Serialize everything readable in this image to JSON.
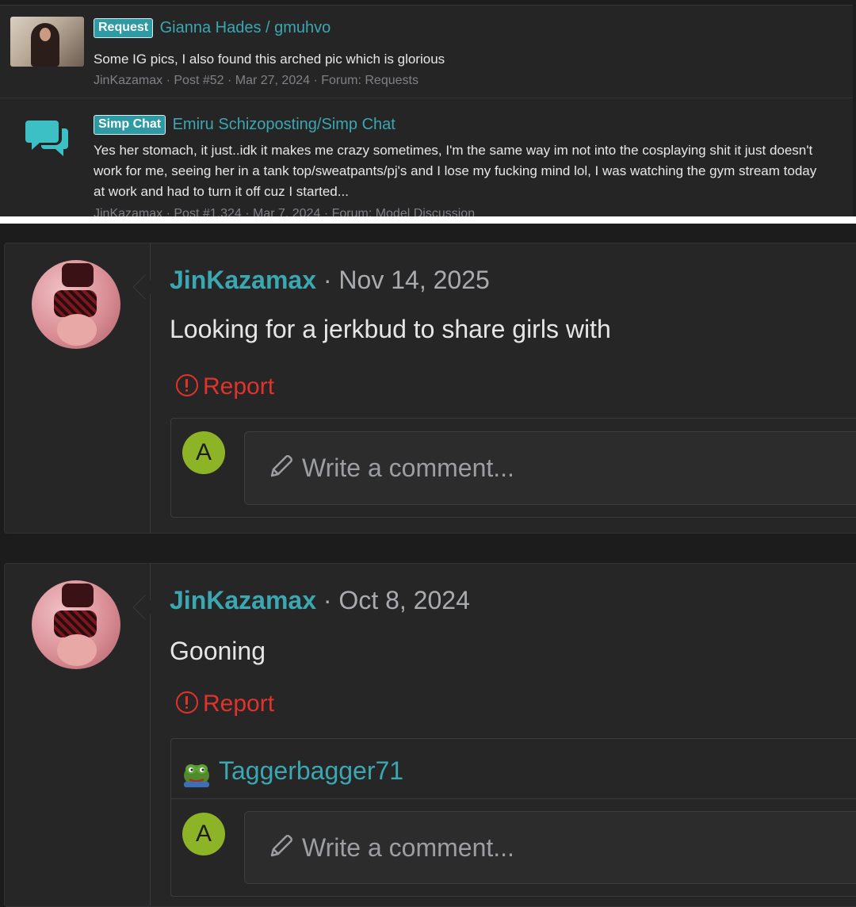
{
  "search_results": [
    {
      "badge": "Request",
      "title": "Gianna Hades / gmuhvo",
      "snippet": "Some IG pics, I also found this arched pic which is glorious",
      "meta": "JinKazamax · Post #52 · Mar 27, 2024 · Forum: Requests"
    },
    {
      "badge": "Simp Chat",
      "title": "Emiru Schizoposting/Simp Chat",
      "snippet": "Yes her stomach, it just..idk it makes me crazy sometimes, I'm the same way im not into the cosplaying shit it just doesn't work for me, seeing her in a tank top/sweatpants/pj's and I lose my fucking mind lol, I was watching the gym stream today at work and had to turn it off cuz I started...",
      "meta": "JinKazamax · Post #1,324 · Mar 7, 2024 · Forum: Model Discussion"
    }
  ],
  "posts": [
    {
      "author": "JinKazamax",
      "date": " · Nov 14, 2025",
      "body": "Looking for a jerkbud to share girls with",
      "report_label": "Report",
      "commenter_initial": "A",
      "comment_placeholder": "Write a comment..."
    },
    {
      "author": "JinKazamax",
      "date": " · Oct 8, 2024",
      "body": "Gooning",
      "report_label": "Report",
      "liker": "Taggerbagger71",
      "commenter_initial": "A",
      "comment_placeholder": "Write a comment..."
    }
  ],
  "colors": {
    "accent": "#3aa7b1",
    "report": "#e0332b",
    "avatar_a": "#8db427",
    "background": "#1c1c1d"
  },
  "icons": [
    "chat-bubbles-icon",
    "report-icon",
    "pencil-icon",
    "pepe-frog-icon"
  ]
}
